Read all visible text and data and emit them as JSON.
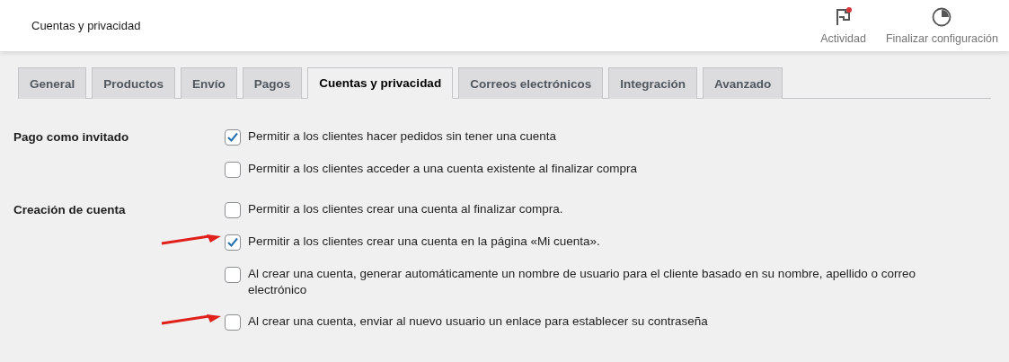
{
  "header": {
    "title": "Cuentas y privacidad",
    "actions": [
      {
        "kind": "activity",
        "label": "Actividad",
        "notification": true
      },
      {
        "kind": "setup",
        "label": "Finalizar configuración"
      }
    ]
  },
  "tabs": [
    {
      "label": "General",
      "selected": false
    },
    {
      "label": "Productos",
      "selected": false
    },
    {
      "label": "Envío",
      "selected": false
    },
    {
      "label": "Pagos",
      "selected": false
    },
    {
      "label": "Cuentas y privacidad",
      "selected": true
    },
    {
      "label": "Correos electrónicos",
      "selected": false
    },
    {
      "label": "Integración",
      "selected": false
    },
    {
      "label": "Avanzado",
      "selected": false
    }
  ],
  "sections": [
    {
      "label": "Pago como invitado",
      "options": [
        {
          "label": "Permitir a los clientes hacer pedidos sin tener una cuenta",
          "checked": true,
          "annotated": false
        },
        {
          "label": "Permitir a los clientes acceder a una cuenta existente al finalizar compra",
          "checked": false,
          "annotated": false
        }
      ]
    },
    {
      "label": "Creación de cuenta",
      "options": [
        {
          "label": "Permitir a los clientes crear una cuenta al finalizar compra.",
          "checked": false,
          "annotated": false
        },
        {
          "label": "Permitir a los clientes crear una cuenta en la página «Mi cuenta».",
          "checked": true,
          "annotated": true
        },
        {
          "label": "Al crear una cuenta, generar automáticamente un nombre de usuario para el cliente basado en su nombre, apellido o correo electrónico",
          "checked": false,
          "annotated": false
        },
        {
          "label": "Al crear una cuenta, enviar al nuevo usuario un enlace para establecer su contraseña",
          "checked": false,
          "annotated": true
        }
      ]
    }
  ]
}
